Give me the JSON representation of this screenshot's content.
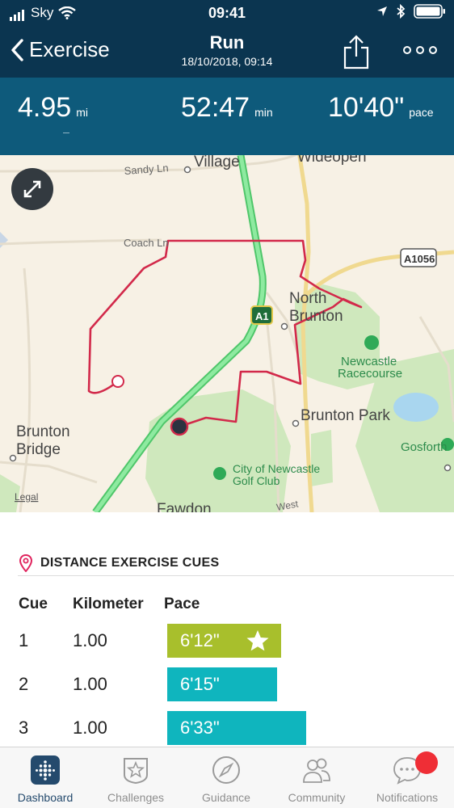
{
  "status_bar": {
    "carrier": "Sky",
    "time": "09:41"
  },
  "nav": {
    "back_label": "Exercise",
    "title": "Run",
    "subtitle": "18/10/2018, 09:14"
  },
  "stats": [
    {
      "value": "4.95",
      "unit": "mi"
    },
    {
      "value": "52:47",
      "unit": "min"
    },
    {
      "value": "10'40\"",
      "unit": "pace"
    }
  ],
  "map": {
    "labels": {
      "village": "Village",
      "wideopen": "Wideopen",
      "sandy_ln": "Sandy Ln",
      "coach_ln": "Coach Ln",
      "a1056": "A1056",
      "north": "North",
      "brunton": "Brunton",
      "a1": "A1",
      "newcastle": "Newcastle",
      "racecourse": "Racecourse",
      "brunton_park": "Brunton Park",
      "brunton_bridge_1": "Brunton",
      "brunton_bridge_2": "Bridge",
      "gosforth": "Gosforth",
      "city_of_newcastle": "City of Newcastle",
      "golf_club": "Golf Club",
      "fawdon": "Fawdon",
      "west": "West",
      "legal": "Legal"
    }
  },
  "cues": {
    "title": "DISTANCE EXERCISE CUES",
    "headers": {
      "cue": "Cue",
      "kilometer": "Kilometer",
      "pace": "Pace"
    },
    "rows": [
      {
        "cue": "1",
        "km": "1.00",
        "pace": "6'12\"",
        "fill": 0.64,
        "color": "#a8bf2c",
        "best": true
      },
      {
        "cue": "2",
        "km": "1.00",
        "pace": "6'15\"",
        "fill": 0.62,
        "color": "#0fb5be",
        "best": false
      },
      {
        "cue": "3",
        "km": "1.00",
        "pace": "6'33\"",
        "fill": 0.78,
        "color": "#0fb5be",
        "best": false
      }
    ]
  },
  "tabs": [
    {
      "label": "Dashboard",
      "icon": "dashboard-icon",
      "active": true
    },
    {
      "label": "Challenges",
      "icon": "challenges-star-icon",
      "active": false
    },
    {
      "label": "Guidance",
      "icon": "compass-icon",
      "active": false
    },
    {
      "label": "Community",
      "icon": "community-icon",
      "active": false
    },
    {
      "label": "Notifications",
      "icon": "notifications-chat-icon",
      "active": false
    }
  ],
  "colors": {
    "header": "#0b3550",
    "stats_bg": "#0e5a7b",
    "route": "#d2294a",
    "road_green": "#7ee08c",
    "accent": "#e0245e"
  }
}
